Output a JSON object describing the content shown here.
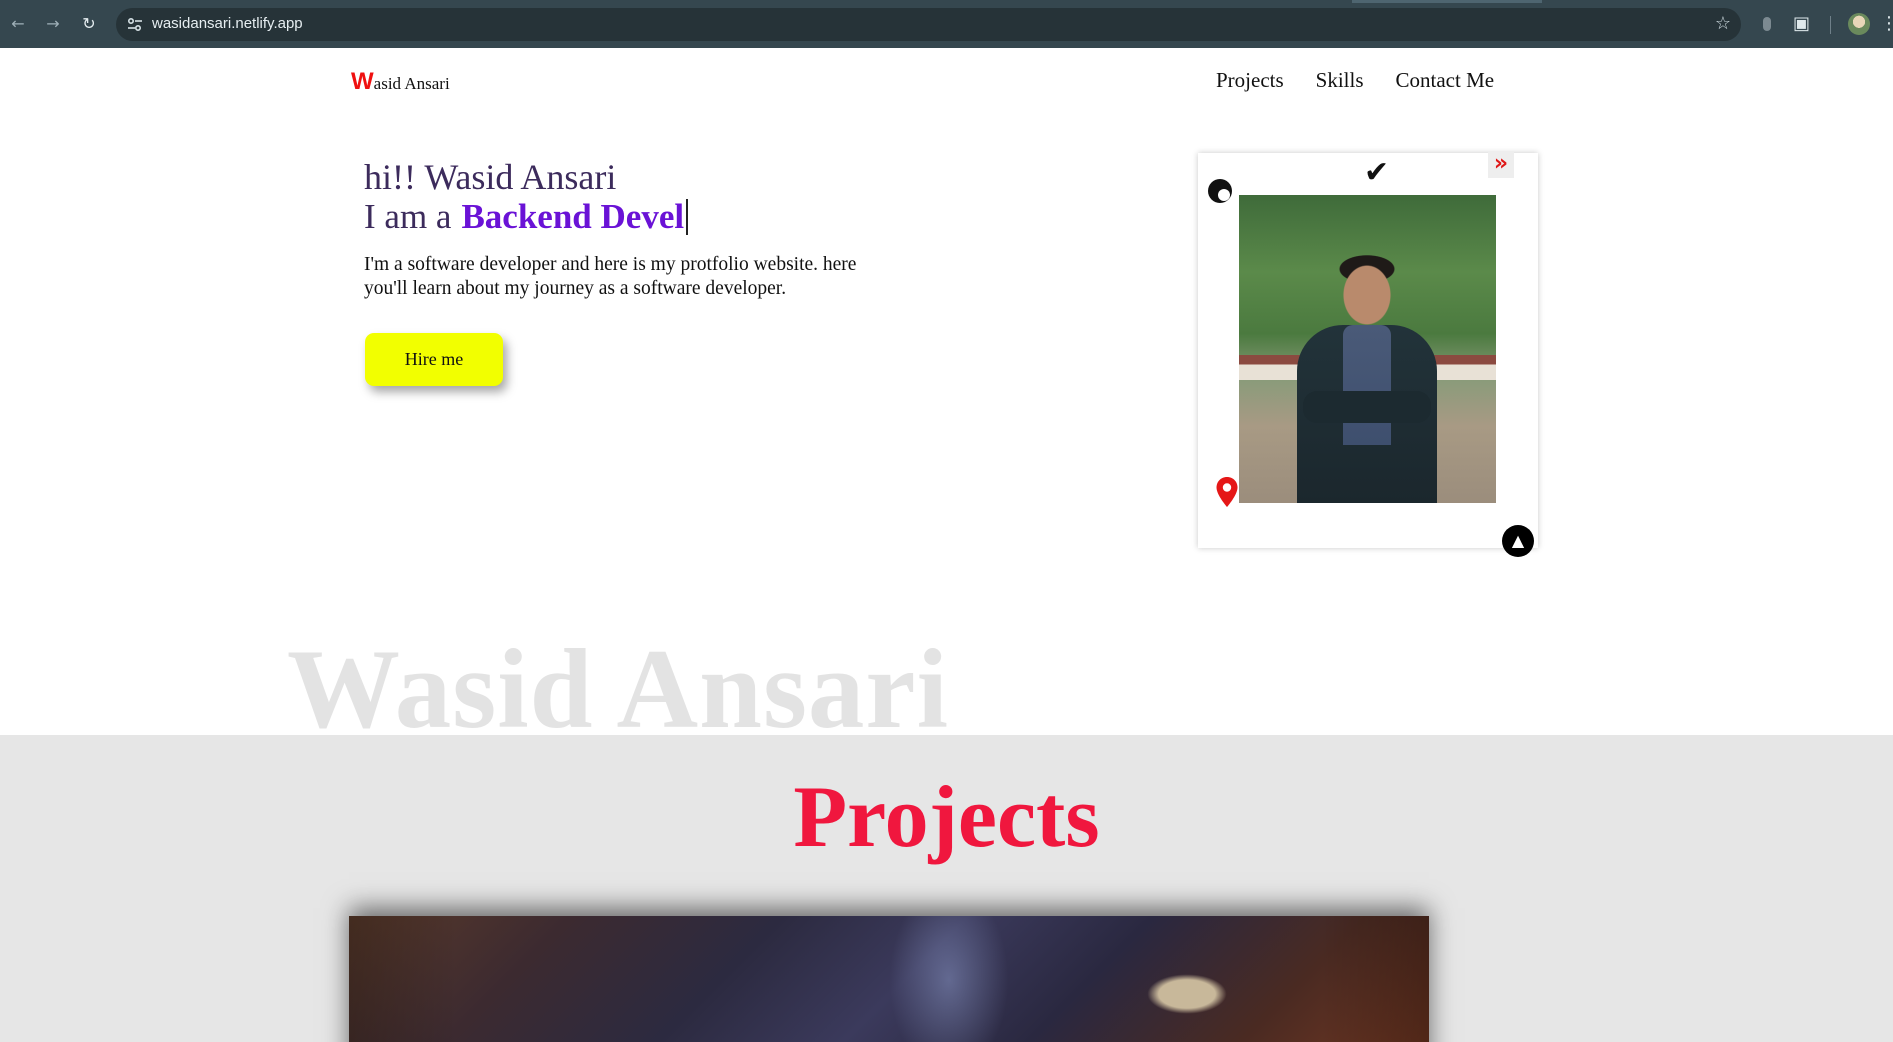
{
  "browser": {
    "url": "wasidansari.netlify.app"
  },
  "site": {
    "logo_mark": "W",
    "logo_text": "asid Ansari",
    "nav": [
      "Projects",
      "Skills",
      "Contact Me"
    ]
  },
  "hero": {
    "greeting": "hi!! Wasid Ansari",
    "role_prefix": "I am a",
    "role_typed": "Backend Devel",
    "description": "I'm a software developer and here is my protfolio website. here you'll learn about my journey as a software developer.",
    "hire_button": "Hire me"
  },
  "profile_card": {
    "icons": [
      "check-icon",
      "double-chevron-right-icon",
      "moon-icon",
      "location-pin-icon",
      "arrow-up-icon"
    ]
  },
  "watermark": "Wasid Ansari",
  "projects": {
    "title": "Projects"
  },
  "colors": {
    "logo": "#ef1010",
    "typed_role": "#6a12d6",
    "hire_button": "#f2ff00",
    "projects_title": "#f0173e",
    "chrome": "#35474f"
  }
}
